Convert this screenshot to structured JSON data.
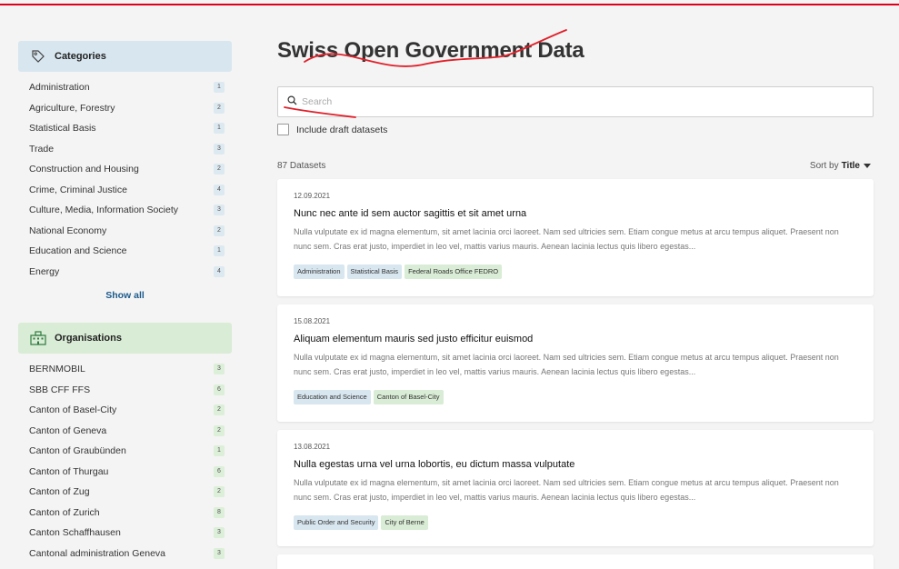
{
  "title": "Swiss Open Government Data",
  "search": {
    "placeholder": "Search"
  },
  "draft_label": "Include draft datasets",
  "dataset_count": "87 Datasets",
  "sort": {
    "prefix": "Sort by",
    "value": "Title"
  },
  "colors": {
    "accent_red": "#dc0018",
    "category_bg": "#d8e6ef",
    "organisation_bg": "#d9ecd5",
    "link": "#1c5a8c"
  },
  "categories": {
    "header": "Categories",
    "icon": "tag-icon",
    "show_all": "Show all",
    "items": [
      {
        "label": "Administration",
        "count": "1"
      },
      {
        "label": "Agriculture, Forestry",
        "count": "2"
      },
      {
        "label": "Statistical Basis",
        "count": "1"
      },
      {
        "label": "Trade",
        "count": "3"
      },
      {
        "label": "Construction and Housing",
        "count": "2"
      },
      {
        "label": "Crime, Criminal Justice",
        "count": "4"
      },
      {
        "label": "Culture, Media, Information Society",
        "count": "3"
      },
      {
        "label": "National Economy",
        "count": "2"
      },
      {
        "label": "Education and Science",
        "count": "1"
      },
      {
        "label": "Energy",
        "count": "4"
      }
    ]
  },
  "organisations": {
    "header": "Organisations",
    "icon": "building-icon",
    "items": [
      {
        "label": "BERNMOBIL",
        "count": "3"
      },
      {
        "label": "SBB CFF FFS",
        "count": "6"
      },
      {
        "label": "Canton of Basel-City",
        "count": "2"
      },
      {
        "label": "Canton of Geneva",
        "count": "2"
      },
      {
        "label": "Canton of Graubünden",
        "count": "1"
      },
      {
        "label": "Canton of Thurgau",
        "count": "6"
      },
      {
        "label": "Canton of Zug",
        "count": "2"
      },
      {
        "label": "Canton of Zurich",
        "count": "8"
      },
      {
        "label": "Canton Schaffhausen",
        "count": "3"
      },
      {
        "label": "Cantonal administration Geneva",
        "count": "3"
      }
    ]
  },
  "datasets": [
    {
      "date": "12.09.2021",
      "title": "Nunc nec ante id sem auctor sagittis et sit amet urna",
      "description": "Nulla vulputate ex id magna elementum, sit amet lacinia orci laoreet. Nam sed ultricies sem. Etiam congue metus at arcu tempus aliquet. Praesent non nunc sem. Cras erat justo, imperdiet in leo vel, mattis varius mauris. Aenean lacinia lectus quis libero egestas...",
      "tags": [
        {
          "label": "Administration",
          "kind": "cat"
        },
        {
          "label": "Statistical Basis",
          "kind": "cat"
        },
        {
          "label": "Federal Roads Office FEDRO",
          "kind": "org"
        }
      ]
    },
    {
      "date": "15.08.2021",
      "title": "Aliquam elementum mauris sed justo efficitur euismod",
      "description": "Nulla vulputate ex id magna elementum, sit amet lacinia orci laoreet. Nam sed ultricies sem. Etiam congue metus at arcu tempus aliquet. Praesent non nunc sem. Cras erat justo, imperdiet in leo vel, mattis varius mauris. Aenean lacinia lectus quis libero egestas...",
      "tags": [
        {
          "label": "Education and Science",
          "kind": "cat"
        },
        {
          "label": "Canton of Basel-City",
          "kind": "org"
        }
      ]
    },
    {
      "date": "13.08.2021",
      "title": "Nulla egestas urna vel urna lobortis, eu dictum massa vulputate",
      "description": "Nulla vulputate ex id magna elementum, sit amet lacinia orci laoreet. Nam sed ultricies sem. Etiam congue metus at arcu tempus aliquet. Praesent non nunc sem. Cras erat justo, imperdiet in leo vel, mattis varius mauris. Aenean lacinia lectus quis libero egestas...",
      "tags": [
        {
          "label": "Public Order and Security",
          "kind": "cat"
        },
        {
          "label": "City of Berne",
          "kind": "org"
        }
      ]
    }
  ]
}
